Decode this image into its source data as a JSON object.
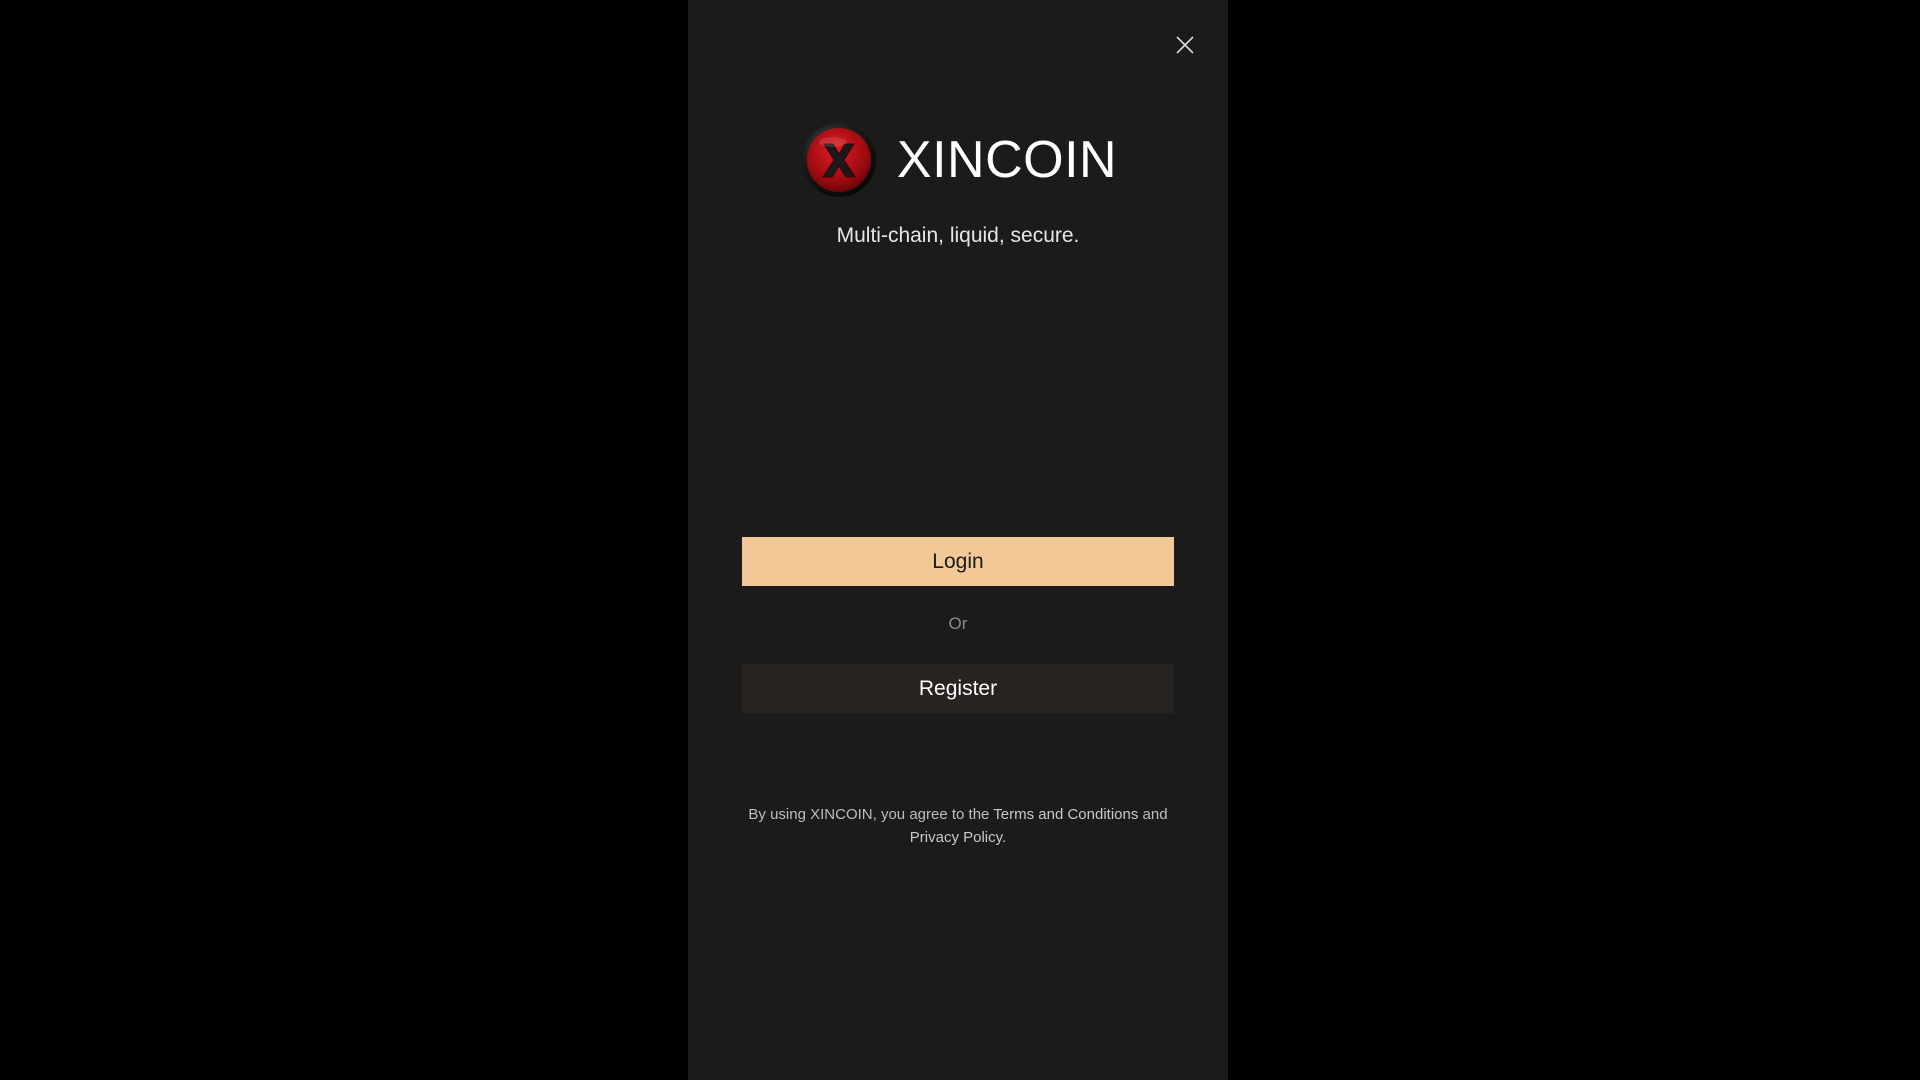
{
  "brand": {
    "name": "XINCOIN",
    "tagline": "Multi-chain, liquid, secure.",
    "logo_icon": "xincoin-logo-icon",
    "logo_letter": "X"
  },
  "actions": {
    "login_label": "Login",
    "or_label": "Or",
    "register_label": "Register"
  },
  "legal": {
    "prefix": "By using XINCOIN, you agree to the",
    "terms_label": "Terms and Conditions",
    "and_label": "and",
    "privacy_label": "Privacy Policy",
    "suffix": "."
  },
  "icons": {
    "close": "close-icon"
  },
  "colors": {
    "page_background": "#000000",
    "panel_background": "#1b1b1b",
    "login_button": "#f2c896",
    "register_button": "#262321",
    "logo_red": "#c8101a"
  }
}
